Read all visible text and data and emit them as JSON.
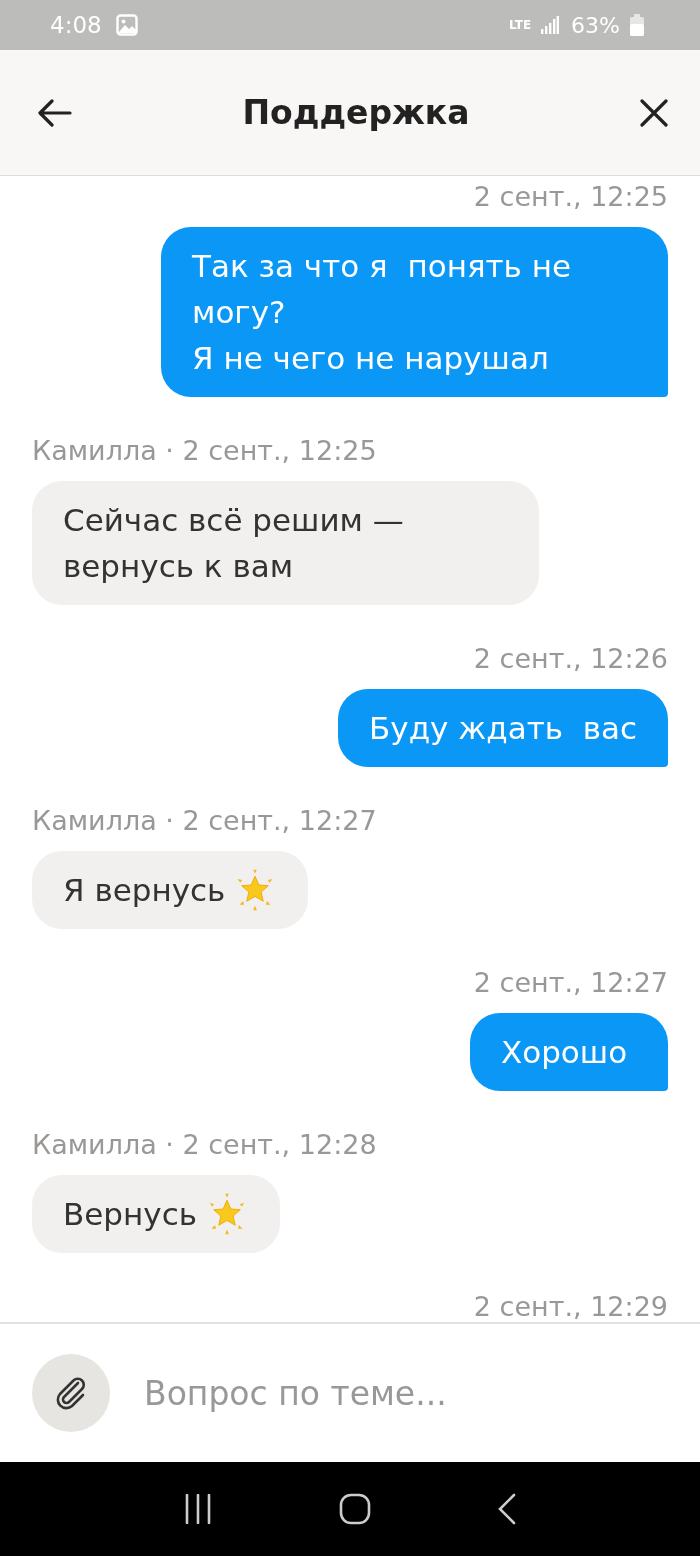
{
  "status_bar": {
    "time": "4:08",
    "network": "LTE",
    "battery": "63%"
  },
  "header": {
    "title": "Поддержка"
  },
  "messages": [
    {
      "kind": "outgoing",
      "time": "2 сент., 12:25",
      "text": "Так за что я  понять не могу?\nЯ не чего не нарушал",
      "star": false
    },
    {
      "kind": "incoming",
      "meta": "Камилла · 2 сент., 12:25",
      "text": "Сейчас всё решим — вернусь к вам",
      "star": false
    },
    {
      "kind": "outgoing",
      "time": "2 сент., 12:26",
      "text": "Буду ждать  вас",
      "star": false
    },
    {
      "kind": "incoming",
      "meta": "Камилла · 2 сент., 12:27",
      "text": "Я вернусь",
      "star": true
    },
    {
      "kind": "outgoing",
      "time": "2 сент., 12:27",
      "text": "Хорошо ",
      "star": false
    },
    {
      "kind": "incoming",
      "meta": "Камилла · 2 сент., 12:28",
      "text": "Вернусь",
      "star": true
    },
    {
      "kind": "outgoing",
      "time": "2 сент., 12:29"
    }
  ],
  "composer": {
    "placeholder": "Вопрос по теме..."
  }
}
